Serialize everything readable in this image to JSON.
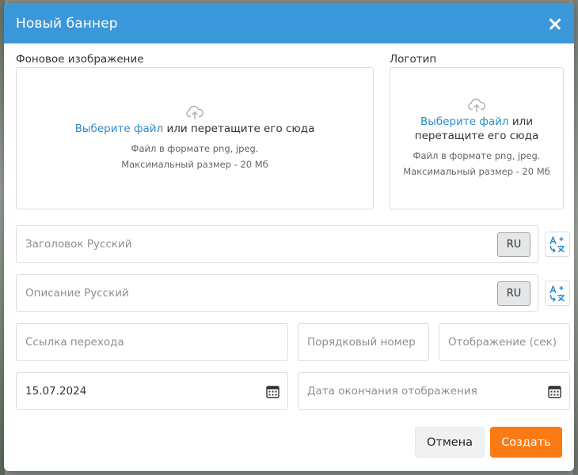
{
  "dialog": {
    "title": "Новый баннер",
    "colors": {
      "header": "#3a97d9",
      "accent_link": "#2b8bc8",
      "primary_button": "#fb7a14"
    }
  },
  "background_upload": {
    "label": "Фоновое изображение",
    "link_text": "Выберите файл",
    "rest_text": " или перетащите его сюда",
    "hint_format": "Файл в формате png, jpeg.",
    "hint_size": "Максимальный размер - 20 Мб",
    "icon": "upload-cloud-icon"
  },
  "logo_upload": {
    "label": "Логотип",
    "link_text": "Выберите файл",
    "rest_text_line1": " или",
    "rest_text_line2": "перетащите его сюда",
    "hint_format": "Файл в формате png, jpeg.",
    "hint_size": "Максимальный размер - 20 Мб",
    "icon": "upload-cloud-icon"
  },
  "form": {
    "title_field": {
      "placeholder": "Заголовок Русский",
      "value": "",
      "lang": "RU"
    },
    "description_field": {
      "placeholder": "Описание Русский",
      "value": "",
      "lang": "RU"
    },
    "link_field": {
      "placeholder": "Ссылка перехода",
      "value": ""
    },
    "order_field": {
      "placeholder": "Порядковый номер",
      "value": ""
    },
    "display_field": {
      "placeholder": "Отображение (сек)",
      "value": ""
    },
    "start_date_field": {
      "placeholder": "",
      "value": "15.07.2024"
    },
    "end_date_field": {
      "placeholder": "Дата окончания отображения",
      "value": ""
    },
    "translate_icon": "translate-icon",
    "calendar_icon": "calendar-icon"
  },
  "footer": {
    "cancel_label": "Отмена",
    "create_label": "Создать"
  }
}
